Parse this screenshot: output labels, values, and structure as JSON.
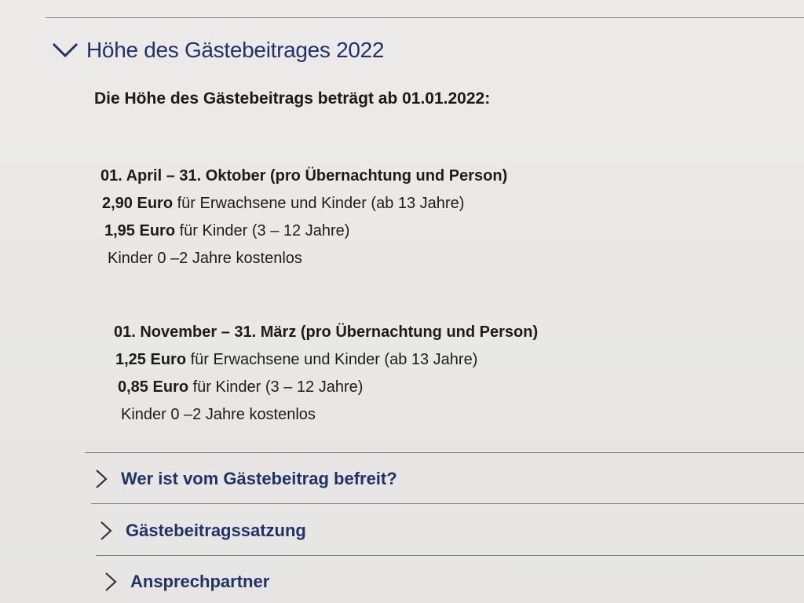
{
  "section": {
    "title": "Höhe des Gästebeitrages 2022",
    "intro": "Die Höhe des Gästebeitrags beträgt ab 01.01.2022:"
  },
  "summer": {
    "heading": "01. April – 31. Oktober (pro Übernachtung und Person)",
    "adult_price": "2,90 Euro",
    "adult_text": " für Erwachsene und Kinder (ab 13 Jahre)",
    "child_price": "1,95 Euro",
    "child_text": " für Kinder (3 – 12 Jahre)",
    "free_text": "Kinder 0 –2 Jahre kostenlos"
  },
  "winter": {
    "heading": "01. November – 31. März (pro Übernachtung und Person)",
    "adult_price": "1,25 Euro",
    "adult_text": " für Erwachsene und Kinder (ab 13 Jahre)",
    "child_price": "0,85 Euro",
    "child_text": " für Kinder (3 – 12 Jahre)",
    "free_text": "Kinder 0 –2 Jahre kostenlos"
  },
  "accordion": {
    "items": [
      {
        "label": "Wer ist vom Gästebeitrag befreit?"
      },
      {
        "label": "Gästebeitragssatzung"
      },
      {
        "label": "Ansprechpartner"
      }
    ]
  },
  "colors": {
    "link": "#1f3366",
    "text": "#1c1c1c",
    "background": "#eae9e7"
  },
  "icons": {
    "expanded": "chevron-down-icon",
    "collapsed": "chevron-right-icon"
  }
}
